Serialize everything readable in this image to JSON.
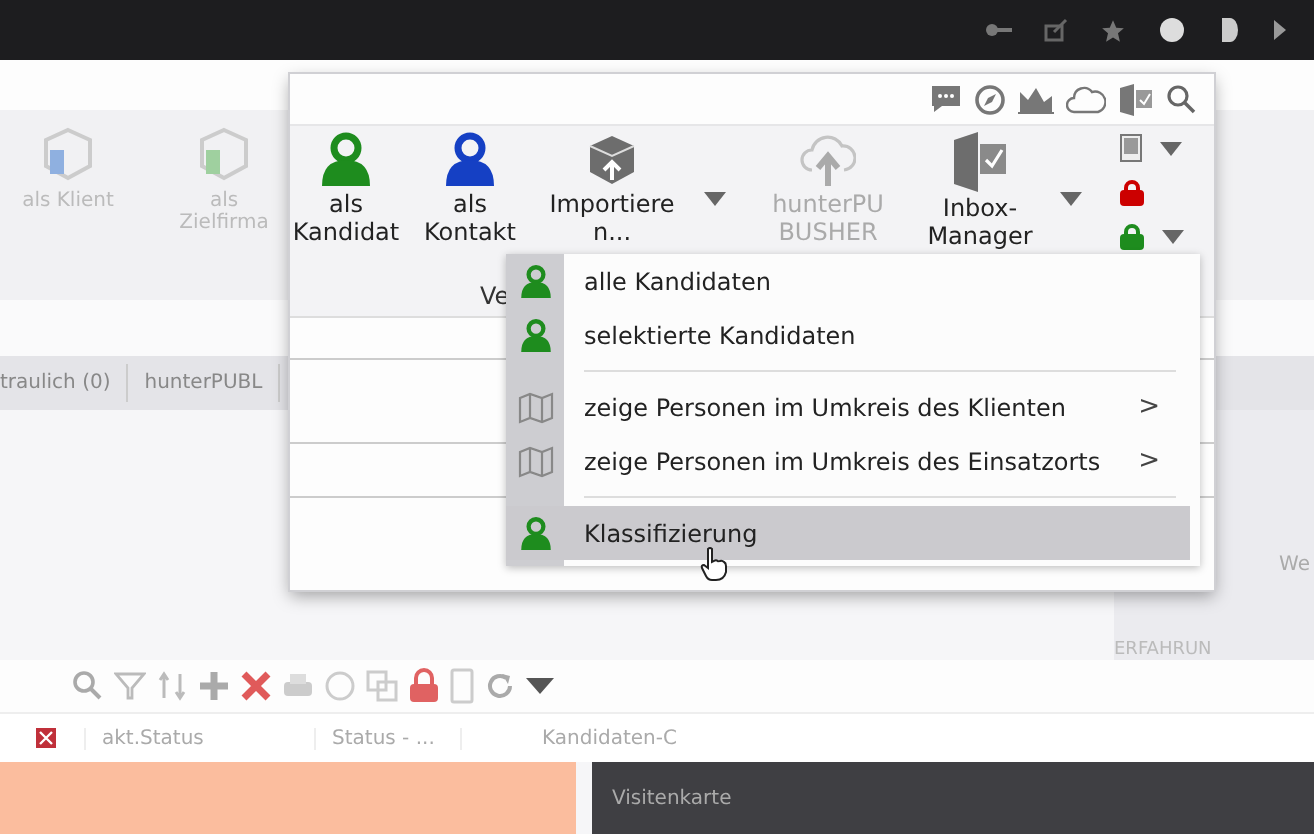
{
  "background": {
    "ribbon_buttons": [
      {
        "label": "als Klient",
        "color": "#8fb0e0"
      },
      {
        "label": "als Zielfirma",
        "color": "#9fd09f"
      }
    ],
    "tabs": [
      {
        "label": "traulich (0)"
      },
      {
        "label": "hunterPUBL"
      }
    ],
    "side_labels": [
      "We",
      "ERFAHRUN"
    ],
    "table": {
      "columns": [
        "akt.Status",
        "Status - ...",
        "Kandidaten-C"
      ]
    },
    "panel_title": "Visitenkarte"
  },
  "popup": {
    "ribbon": [
      {
        "label": "als Kandidat",
        "kind": "person",
        "color": "#1e8c1e",
        "dropdown": false,
        "disabled": false
      },
      {
        "label": "als Kontakt",
        "kind": "person",
        "color": "#1540c4",
        "dropdown": false,
        "disabled": false
      },
      {
        "label": "Importiere n...",
        "kind": "import",
        "dropdown": true,
        "disabled": false
      },
      {
        "label": "hunterPU BUSHER",
        "kind": "upload",
        "dropdown": false,
        "disabled": true
      },
      {
        "label": "Inbox-Manager",
        "kind": "inbox",
        "dropdown": true,
        "disabled": false
      }
    ],
    "group_label": "Ve",
    "menu": {
      "groups": [
        [
          {
            "label": "alle Kandidaten",
            "kind": "person",
            "submenu": false,
            "selected": false
          },
          {
            "label": "selektierte Kandidaten",
            "kind": "person",
            "submenu": false,
            "selected": false
          }
        ],
        [
          {
            "label": "zeige Personen im Umkreis des Klienten",
            "kind": "map",
            "submenu": true,
            "selected": false
          },
          {
            "label": "zeige Personen im Umkreis des Einsatzorts",
            "kind": "map",
            "submenu": true,
            "selected": false
          }
        ],
        [
          {
            "label": "Klassifizierung",
            "kind": "person",
            "submenu": false,
            "selected": true
          }
        ]
      ]
    },
    "submenu_sign": ">"
  }
}
